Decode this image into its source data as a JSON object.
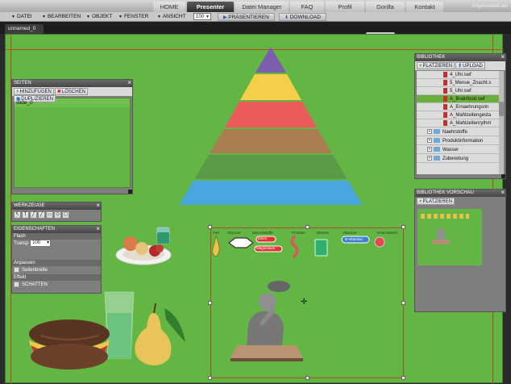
{
  "topnav": {
    "tabs": [
      "HOME",
      "Presenter",
      "Datei Manager",
      "FAQ",
      "Profil",
      "Gorilla",
      "Kontakt"
    ],
    "active": "Presenter",
    "login": "Angemeldet als"
  },
  "menubar": {
    "items": [
      "DATEI",
      "BEARBEITEN",
      "OBJEKT",
      "FENSTER",
      "ANSICHT"
    ],
    "zoom": "100",
    "present": "PRÄSENTIEREN",
    "download": "DOWNLOAD"
  },
  "document": {
    "tab": "unnamed_0"
  },
  "slides_panel": {
    "title": "SEITEN",
    "add": "HINZUFÜGEN",
    "delete": "LÖSCHEN",
    "duplicate": "DUPLIZIEREN",
    "slide": "slide_0"
  },
  "library_panel": {
    "title": "BIBLIOTHEK",
    "place": "PLATZIEREN",
    "upload": "UPLOAD",
    "files": [
      "4_Uhr.swf",
      "5_Menue_Znacht.s",
      "5_Uhr.swf",
      "A_Brainfood.swf",
      "A_Ernaehrungsrin",
      "A_Mahlzeitengesta",
      "A_Mahlzeitenrythm"
    ],
    "selected_index": 3,
    "folders": [
      "Naehrstoffe",
      "Produktinformation",
      "Wasser",
      "Zubereitung"
    ]
  },
  "preview_panel": {
    "title": "BIBLIOTHEK VORSCHAU",
    "place": "PLATZIEREN"
  },
  "tools_panel": {
    "title": "WERKZEUGE",
    "tools": [
      "↖",
      "T",
      "╱",
      "╱",
      "▭",
      "⬭",
      "⬡"
    ]
  },
  "props_panel": {
    "title": "EIGENSCHAFTEN",
    "section_flash": "Flash",
    "transp_label": "Transp",
    "transp_value": "100",
    "section_adjust": "Anpassen",
    "adjust_option": "Seitenbreite",
    "section_effect": "Effekt",
    "effect_option": "SCHATTEN"
  },
  "canvas": {
    "pictogram_labels": [
      "Fett",
      "Glucose",
      "Mineralstoffe",
      "Proteine",
      "Wasser",
      "Vitamine",
      "Aminosäuren"
    ],
    "pill_labels": [
      "Eisen",
      "Magnesium",
      "B-Vitamine"
    ],
    "pyramid_colors": [
      "#7b5fae",
      "#f6cf4a",
      "#ec5a5a",
      "#a87d4f",
      "#5b9a48",
      "#4aa6df"
    ]
  }
}
